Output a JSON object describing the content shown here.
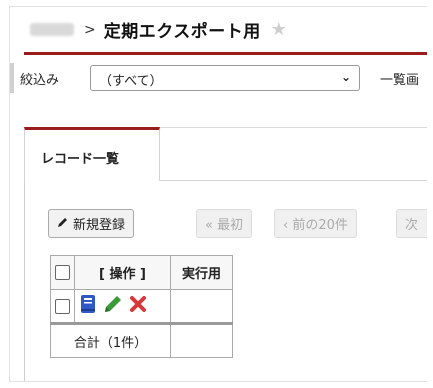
{
  "header": {
    "separator": ">",
    "title": "定期エクスポート用",
    "star": "★"
  },
  "filter": {
    "label": "絞込み",
    "selected": "（すべて）",
    "chevron": "⌄",
    "list_label": "一覧画"
  },
  "tab": {
    "label": "レコード一覧"
  },
  "toolbar": {
    "new_label": "新規登録",
    "first_label": "« 最初",
    "prev_label": "‹ 前の20件",
    "next_label": "次"
  },
  "table": {
    "col_ops": "[ 操作 ]",
    "col_exec": "実行用",
    "total": "合計（1件）"
  },
  "colors": {
    "accent": "#9b1c1c",
    "book": "#2e59c4",
    "pencil": "#3c9a3a",
    "delete": "#d9383a"
  }
}
